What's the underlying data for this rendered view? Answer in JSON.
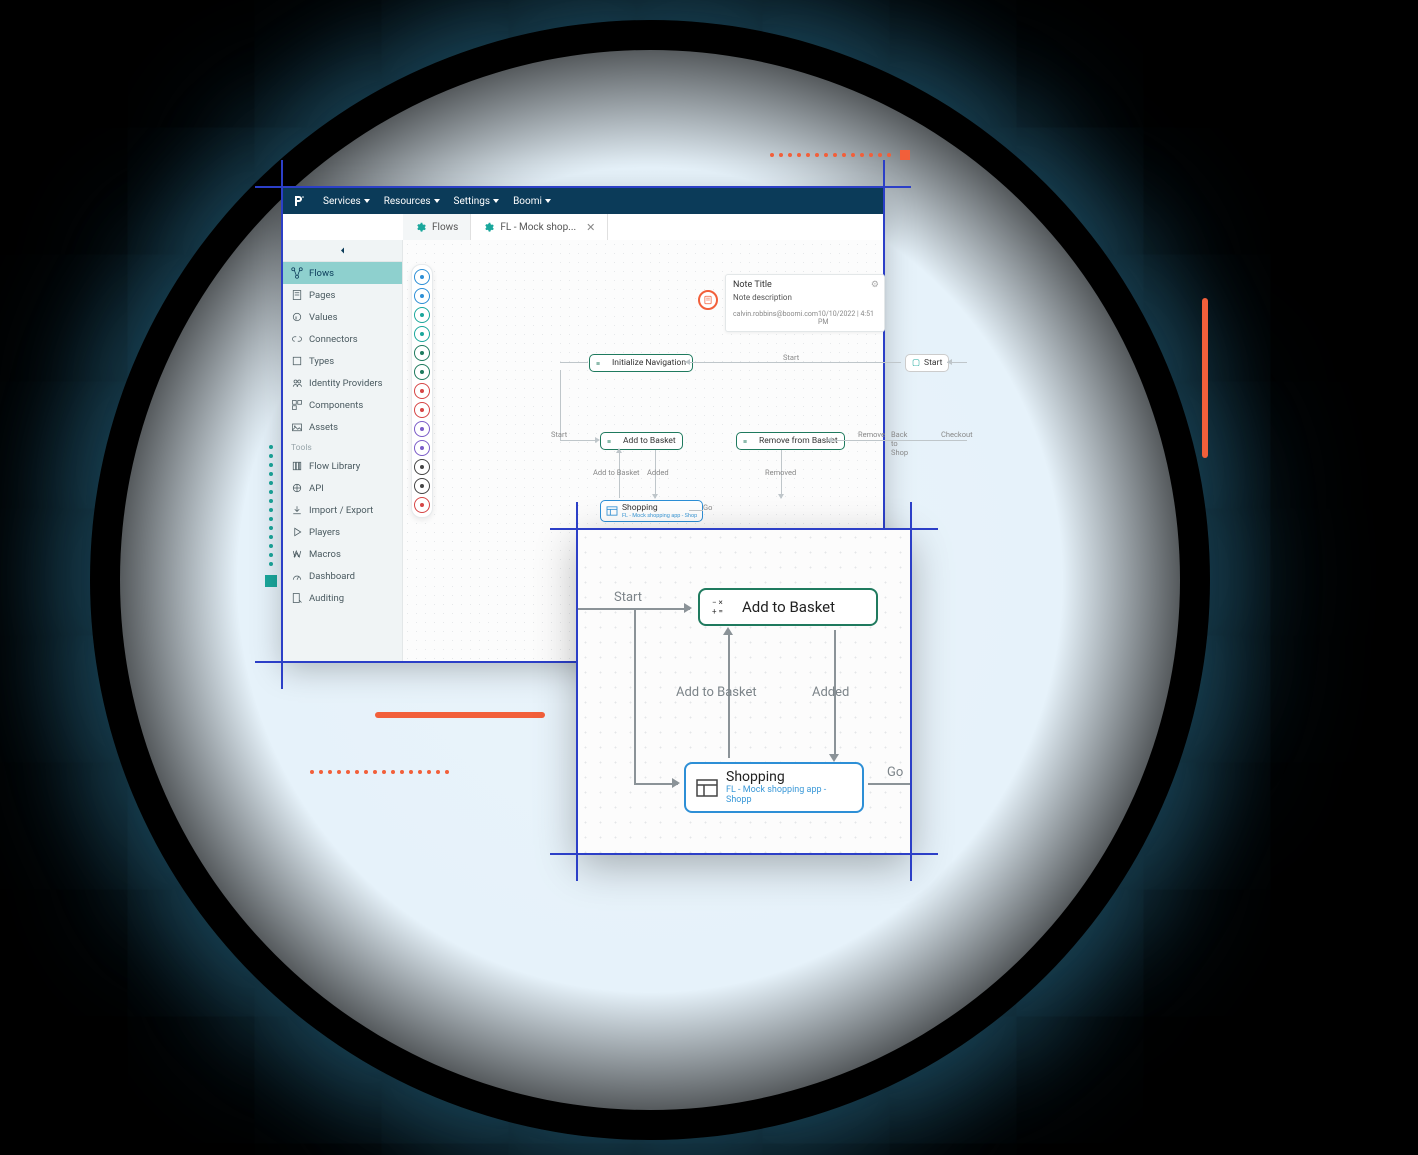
{
  "topnav": {
    "items": [
      "Services",
      "Resources",
      "Settings",
      "Boomi"
    ]
  },
  "tabs": {
    "flows": "Flows",
    "active": "FL - Mock shop..."
  },
  "sidebar": {
    "main": [
      {
        "label": "Flows",
        "icon": "flows"
      },
      {
        "label": "Pages",
        "icon": "pages"
      },
      {
        "label": "Values",
        "icon": "values"
      },
      {
        "label": "Connectors",
        "icon": "connectors"
      },
      {
        "label": "Types",
        "icon": "types"
      },
      {
        "label": "Identity Providers",
        "icon": "identity"
      },
      {
        "label": "Components",
        "icon": "components"
      },
      {
        "label": "Assets",
        "icon": "assets"
      }
    ],
    "tools_header": "Tools",
    "tools": [
      {
        "label": "Flow Library",
        "icon": "library"
      },
      {
        "label": "API",
        "icon": "api"
      },
      {
        "label": "Import / Export",
        "icon": "importexport"
      },
      {
        "label": "Players",
        "icon": "players"
      },
      {
        "label": "Macros",
        "icon": "macros"
      },
      {
        "label": "Dashboard",
        "icon": "dashboard"
      },
      {
        "label": "Auditing",
        "icon": "auditing"
      }
    ]
  },
  "palette": [
    {
      "color": "#2d8fd6"
    },
    {
      "color": "#2d8fd6"
    },
    {
      "color": "#1aa79c"
    },
    {
      "color": "#1aa79c"
    },
    {
      "color": "#1f7a5e"
    },
    {
      "color": "#1f7a5e"
    },
    {
      "color": "#d64545"
    },
    {
      "color": "#d64545"
    },
    {
      "color": "#7b5cc8"
    },
    {
      "color": "#7b5cc8"
    },
    {
      "color": "#444"
    },
    {
      "color": "#444"
    },
    {
      "color": "#d64545"
    }
  ],
  "note": {
    "title": "Note Title",
    "description": "Note description",
    "author": "calvin.robbins@boomi.com",
    "date": "10/10/2022",
    "time": "4:51 PM"
  },
  "nodes": {
    "init_nav": "Initialize Navigation",
    "start": "Start",
    "add_basket": "Add to Basket",
    "remove_basket": "Remove from Basket",
    "shopping_title": "Shopping",
    "shopping_sub": "FL - Mock shopping app - Shop"
  },
  "edges": {
    "start": "Start",
    "add_to_basket": "Add to Basket",
    "added": "Added",
    "removed": "Removed",
    "remove": "Remove",
    "back_to_shop": "Back to Shop",
    "checkout": "Checkout",
    "go": "Go"
  },
  "zoom": {
    "start": "Start",
    "add_basket": "Add to Basket",
    "add_to_basket_lbl": "Add to Basket",
    "added_lbl": "Added",
    "shopping": "Shopping",
    "shopping_sub": "FL - Mock shopping app - Shopp",
    "go": "Go"
  }
}
